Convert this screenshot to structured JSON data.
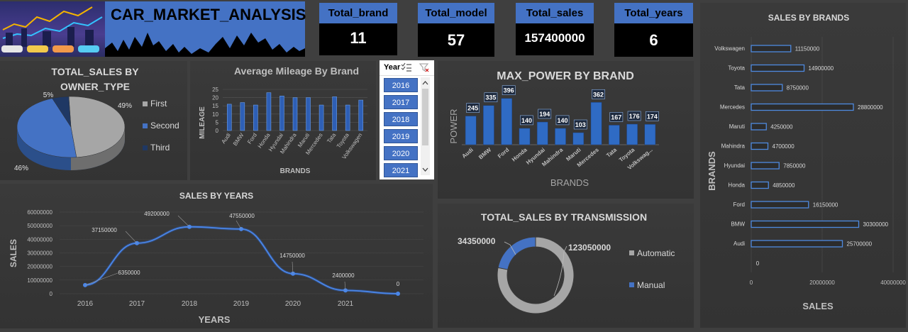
{
  "header": {
    "title": "CAR_MARKET_ANALYSIS"
  },
  "kpis": [
    {
      "label": "Total_brand",
      "value": "11"
    },
    {
      "label": "Total_model",
      "value": "57"
    },
    {
      "label": "Total_sales",
      "value": "157400000"
    },
    {
      "label": "Total_years",
      "value": "6"
    }
  ],
  "slicer": {
    "title": "Year",
    "items": [
      "2016",
      "2017",
      "2018",
      "2019",
      "2020",
      "2021"
    ]
  },
  "colors": {
    "accent": "#4472c4",
    "navy": "#1f3864",
    "grey": "#a6a6a6"
  },
  "chart_data": [
    {
      "type": "pie",
      "title": "TOTAL_SALES BY OWNER_TYPE",
      "categories": [
        "First",
        "Second",
        "Third"
      ],
      "values": [
        49,
        46,
        5
      ],
      "labels": [
        "49%",
        "46%",
        "5%"
      ],
      "legend": "right"
    },
    {
      "type": "bar",
      "title": "Average Mileage By Brand",
      "categories": [
        "Audi",
        "BMW",
        "Ford",
        "Honda",
        "Hyundai",
        "Mahindra",
        "Maruti",
        "Mercedes",
        "Tata",
        "Toyota",
        "Volkswagen"
      ],
      "values": [
        16,
        17,
        15.5,
        23,
        21,
        20,
        20,
        15.5,
        20.5,
        15.5,
        18.5
      ],
      "xlabel": "BRANDS",
      "ylabel": "MILEAGE",
      "yticks": [
        "25",
        "20",
        "15",
        "10",
        "5",
        "0"
      ],
      "ylim": [
        0,
        25
      ]
    },
    {
      "type": "bar",
      "title": "MAX_POWER BY BRAND",
      "categories": [
        "Audi",
        "BMW",
        "Ford",
        "Honda",
        "Hyundai",
        "Mahindra",
        "Maruti",
        "Mercedes",
        "Tata",
        "Toyota",
        "Volkswag..."
      ],
      "values": [
        245,
        335,
        396,
        140,
        194,
        140,
        103,
        362,
        167,
        176,
        174
      ],
      "xlabel": "BRANDS",
      "ylabel": "POWER"
    },
    {
      "type": "bar",
      "title": "SALES BY BRANDS",
      "categories": [
        "Volkswagen",
        "Toyota",
        "Tata",
        "Mercedes",
        "Maruti",
        "Mahindra",
        "Hyundai",
        "Honda",
        "Ford",
        "BMW",
        "Audi"
      ],
      "values": [
        11150000,
        14900000,
        8750000,
        28800000,
        4250000,
        4700000,
        7850000,
        4850000,
        16150000,
        30300000,
        25700000
      ],
      "xlabel": "SALES",
      "ylabel": "BRANDS",
      "xticks": [
        "0",
        "20000000",
        "40000000"
      ],
      "xlim": [
        0,
        40000000
      ],
      "extra_label": "0"
    },
    {
      "type": "line",
      "title": "SALES BY YEARS",
      "x": [
        "2016",
        "2017",
        "2018",
        "2019",
        "2020",
        "2021"
      ],
      "values": [
        6350000,
        37150000,
        49200000,
        47550000,
        14750000,
        2400000
      ],
      "end_label": "0",
      "xlabel": "YEARS",
      "ylabel": "SALES",
      "yticks": [
        "60000000",
        "50000000",
        "40000000",
        "30000000",
        "20000000",
        "10000000",
        "0"
      ],
      "ylim": [
        0,
        60000000
      ]
    },
    {
      "type": "pie",
      "title": "TOTAL_SALES BY TRANSMISSION",
      "categories": [
        "Automatic",
        "Manual"
      ],
      "values": [
        123050000,
        34350000
      ],
      "labels": [
        "123050000",
        "34350000"
      ],
      "legend": "right"
    }
  ]
}
